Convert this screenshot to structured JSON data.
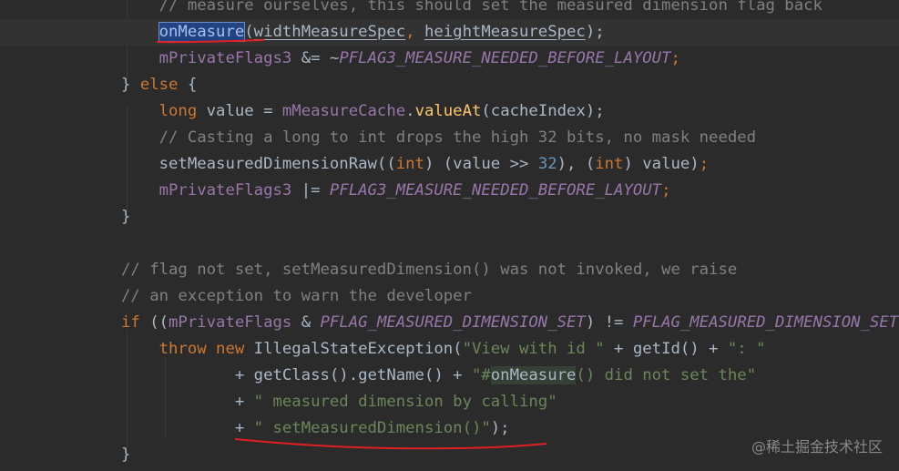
{
  "code_lines": [
    {
      "segments": [
        {
          "text": "    // measure ourselves, this should set the measured dimension flag back",
          "cls": "cmt"
        }
      ]
    },
    {
      "current": true,
      "segments": [
        {
          "text": "    ",
          "cls": "plain"
        },
        {
          "text": "onMeasure",
          "cls": "fn",
          "box": "sel"
        },
        {
          "text": "(",
          "cls": "plain"
        },
        {
          "text": "widthMeasureSpec",
          "cls": "plain ul"
        },
        {
          "text": ", ",
          "cls": "kw"
        },
        {
          "text": "heightMeasureSpec",
          "cls": "plain ul"
        },
        {
          "text": ");",
          "cls": "plain"
        }
      ]
    },
    {
      "segments": [
        {
          "text": "    ",
          "cls": "plain"
        },
        {
          "text": "mPrivateFlags3",
          "cls": "fld"
        },
        {
          "text": " &= ~",
          "cls": "plain"
        },
        {
          "text": "PFLAG3_MEASURE_NEEDED_BEFORE_LAYOUT",
          "cls": "cst"
        },
        {
          "text": ";",
          "cls": "kw"
        }
      ]
    },
    {
      "segments": [
        {
          "text": "} ",
          "cls": "plain"
        },
        {
          "text": "else",
          "cls": "kw"
        },
        {
          "text": " {",
          "cls": "plain"
        }
      ]
    },
    {
      "segments": [
        {
          "text": "    ",
          "cls": "plain"
        },
        {
          "text": "long",
          "cls": "kw"
        },
        {
          "text": " value = ",
          "cls": "plain"
        },
        {
          "text": "mMeasureCache",
          "cls": "fld"
        },
        {
          "text": ".",
          "cls": "plain"
        },
        {
          "text": "valueAt",
          "cls": "mth"
        },
        {
          "text": "(cacheIndex);",
          "cls": "plain"
        }
      ]
    },
    {
      "segments": [
        {
          "text": "    // Casting a long to int drops the high 32 bits, no mask needed",
          "cls": "cmt"
        }
      ]
    },
    {
      "segments": [
        {
          "text": "    setMeasuredDimensionRaw((",
          "cls": "plain"
        },
        {
          "text": "int",
          "cls": "kw"
        },
        {
          "text": ") (value >> ",
          "cls": "plain"
        },
        {
          "text": "32",
          "cls": "num"
        },
        {
          "text": "), (",
          "cls": "plain"
        },
        {
          "text": "int",
          "cls": "kw"
        },
        {
          "text": ") value)",
          "cls": "plain"
        },
        {
          "text": ";",
          "cls": "kw"
        }
      ]
    },
    {
      "segments": [
        {
          "text": "    ",
          "cls": "plain"
        },
        {
          "text": "mPrivateFlags3",
          "cls": "fld"
        },
        {
          "text": " |= ",
          "cls": "plain"
        },
        {
          "text": "PFLAG3_MEASURE_NEEDED_BEFORE_LAYOUT",
          "cls": "cst"
        },
        {
          "text": ";",
          "cls": "kw"
        }
      ]
    },
    {
      "segments": [
        {
          "text": "}",
          "cls": "plain"
        }
      ]
    },
    {
      "segments": [
        {
          "text": "",
          "cls": "plain"
        }
      ]
    },
    {
      "segments": [
        {
          "text": "// flag not set, setMeasuredDimension() was not invoked, we raise",
          "cls": "cmt"
        }
      ]
    },
    {
      "segments": [
        {
          "text": "// an exception to warn the developer",
          "cls": "cmt"
        }
      ]
    },
    {
      "segments": [
        {
          "text": "if",
          "cls": "kw"
        },
        {
          "text": " ((",
          "cls": "plain"
        },
        {
          "text": "mPrivateFlags",
          "cls": "fld"
        },
        {
          "text": " & ",
          "cls": "plain"
        },
        {
          "text": "PFLAG_MEASURED_DIMENSION_SET",
          "cls": "cst"
        },
        {
          "text": ") != ",
          "cls": "plain"
        },
        {
          "text": "PFLAG_MEASURED_DIMENSION_SET",
          "cls": "cst"
        }
      ]
    },
    {
      "segments": [
        {
          "text": "    ",
          "cls": "plain"
        },
        {
          "text": "throw new",
          "cls": "kw"
        },
        {
          "text": " IllegalStateException(",
          "cls": "plain"
        },
        {
          "text": "\"View with id \"",
          "cls": "str"
        },
        {
          "text": " + getId() + ",
          "cls": "plain"
        },
        {
          "text": "\": \"",
          "cls": "str"
        }
      ]
    },
    {
      "segments": [
        {
          "text": "            + getClass().getName() + ",
          "cls": "plain"
        },
        {
          "text": "\"#",
          "cls": "str"
        },
        {
          "text": "onMeasure",
          "cls": "str",
          "box": "match"
        },
        {
          "text": "() did not set the\"",
          "cls": "str"
        }
      ]
    },
    {
      "segments": [
        {
          "text": "            + ",
          "cls": "plain"
        },
        {
          "text": "\" measured dimension by calling\"",
          "cls": "str"
        }
      ]
    },
    {
      "segments": [
        {
          "text": "            + ",
          "cls": "plain"
        },
        {
          "text": "\" setMeasuredDimension()\"",
          "cls": "str"
        },
        {
          "text": ");",
          "cls": "plain"
        }
      ]
    },
    {
      "segments": [
        {
          "text": "}",
          "cls": "plain"
        }
      ]
    }
  ],
  "watermark": "@稀土掘金技术社区"
}
